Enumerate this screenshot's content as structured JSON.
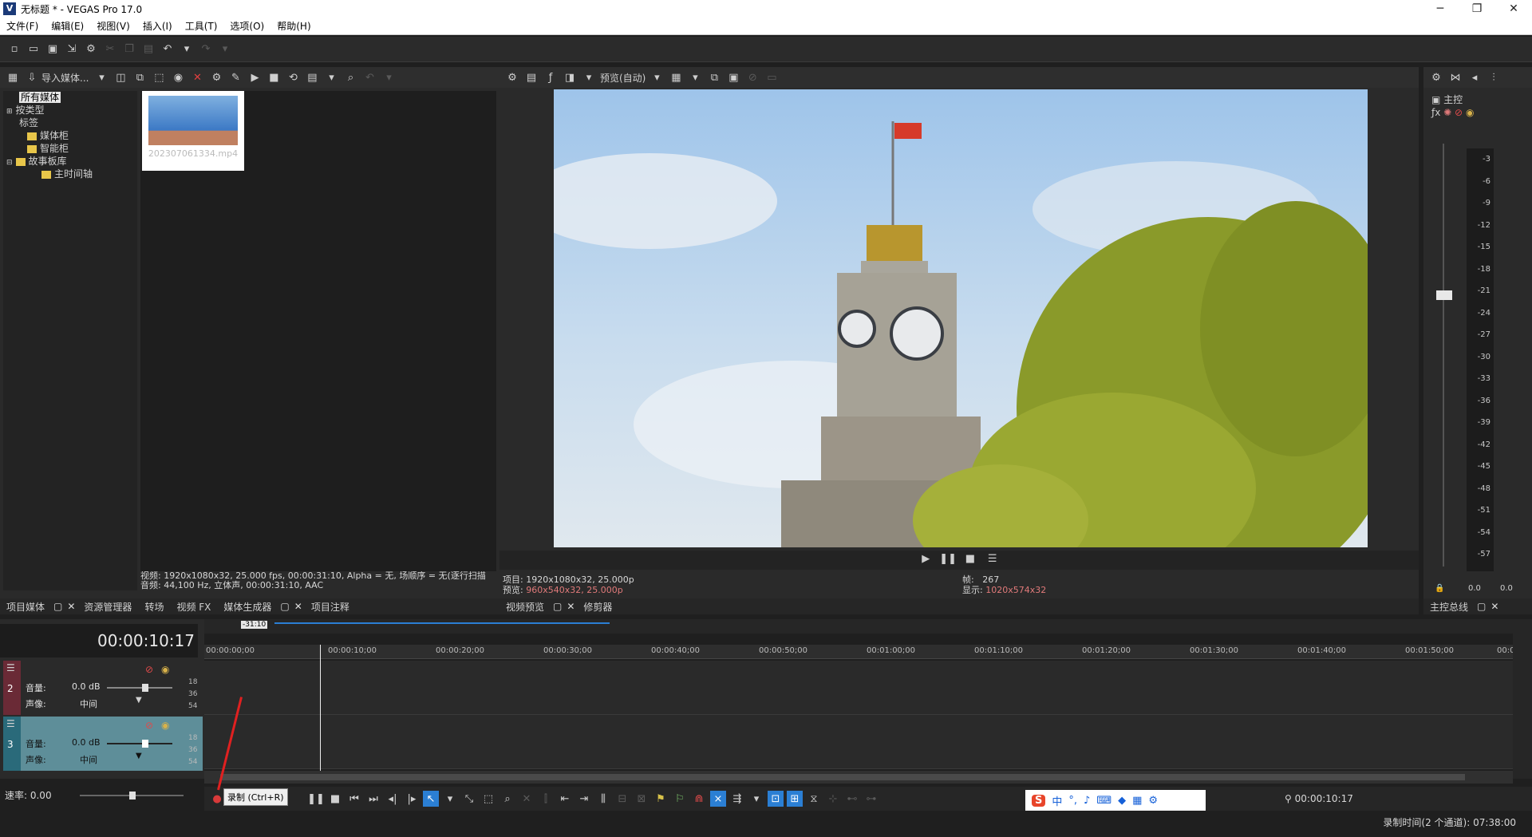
{
  "window": {
    "title": "无标题 * - VEGAS Pro 17.0",
    "app_icon": "V",
    "minimize": "─",
    "maximize": "❐",
    "close": "✕"
  },
  "menu": [
    "文件(F)",
    "编辑(E)",
    "视图(V)",
    "插入(I)",
    "工具(T)",
    "选项(O)",
    "帮助(H)"
  ],
  "media_panel": {
    "import_label": "导入媒体...",
    "tree": [
      {
        "label": "所有媒体",
        "selected": true
      },
      {
        "label": "按类型"
      },
      {
        "label": "标签"
      },
      {
        "label": "媒体柜"
      },
      {
        "label": "智能柜"
      },
      {
        "label": "故事板库"
      },
      {
        "label": "主时间轴"
      }
    ],
    "thumbnail_filename": "202307061334.mp4",
    "info_video": "视频: 1920x1080x32, 25.000 fps, 00:00:31:10, Alpha = 无, 场顺序 = 无(逐行扫描",
    "info_audio": "音频: 44,100 Hz, 立体声, 00:00:31:10, AAC",
    "tabs": [
      "项目媒体",
      "资源管理器",
      "转场",
      "视频 FX",
      "媒体生成器",
      "项目注释"
    ]
  },
  "preview": {
    "mode_label": "预览(自动)",
    "info_project": "项目: 1920x1080x32, 25.000p",
    "info_preview_label": "预览:",
    "info_preview_value": "960x540x32, 25.000p",
    "frame_label": "帧:",
    "frame_value": "267",
    "display_label": "显示:",
    "display_value": "1020x574x32",
    "tabs": [
      "视频预览",
      "修剪器"
    ]
  },
  "master": {
    "title": "主控",
    "meter_scale": [
      "3",
      "6",
      "9",
      "12",
      "15",
      "18",
      "21",
      "24",
      "27",
      "30",
      "33",
      "36",
      "39",
      "42",
      "45",
      "48",
      "51",
      "54",
      "57"
    ],
    "left_value": "0.0",
    "right_value": "0.0",
    "tab": "主控总线"
  },
  "timeline": {
    "timecode": "00:00:10:17",
    "region_label": "-31:10",
    "ruler": [
      "00:00:00;00",
      "00:00:10;00",
      "00:00:20;00",
      "00:00:30;00",
      "00:00:40;00",
      "00:00:50;00",
      "00:01:00;00",
      "00:01:10;00",
      "00:01:20;00",
      "00:01:30;00",
      "00:01:40;00",
      "00:01:50;00",
      "00:0"
    ],
    "tracks": [
      {
        "number": "2",
        "volume_label": "音量:",
        "volume_value": "0.0 dB",
        "pan_label": "声像:",
        "pan_value": "中间",
        "db_marks": [
          "18",
          "36",
          "54"
        ]
      },
      {
        "number": "3",
        "volume_label": "音量:",
        "volume_value": "0.0 dB",
        "pan_label": "声像:",
        "pan_value": "中间",
        "db_marks": [
          "18",
          "36",
          "54"
        ]
      }
    ],
    "rate_label": "速率: 0.00",
    "record_tooltip": "录制 (Ctrl+R)",
    "cursor_time": "00:00:10:17"
  },
  "ime": {
    "logo": "S",
    "lang": "中"
  },
  "status": {
    "record_time": "录制时间(2 个通道): 07:38:00"
  },
  "colors": {
    "accent_blue": "#2b7fd4",
    "record_red": "#d83a3a",
    "track2_color": "#7a2a3a",
    "track3_color": "#2a7a8a"
  }
}
